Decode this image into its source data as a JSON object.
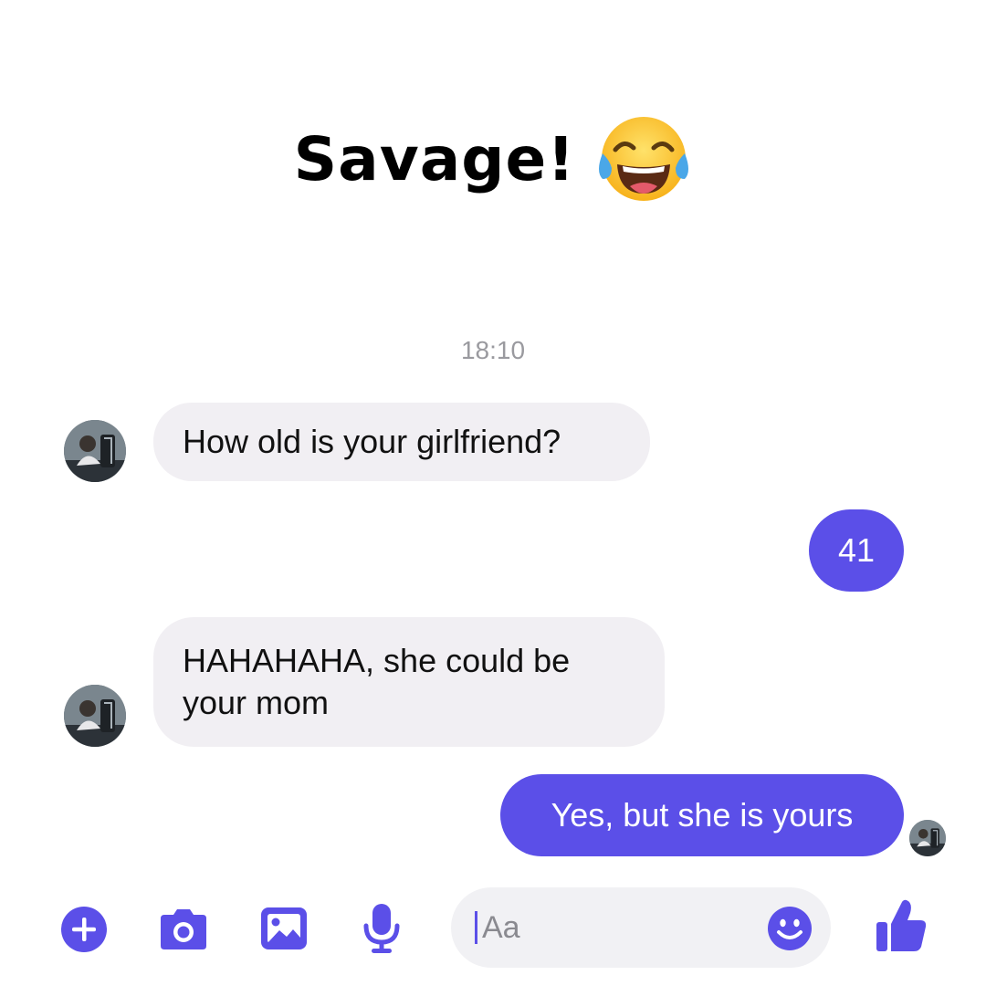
{
  "caption": {
    "text": "Savage!",
    "emoji_icon": "tears-of-joy-emoji"
  },
  "conversation": {
    "timestamp": "18:10",
    "messages": [
      {
        "direction": "incoming",
        "text": "How old is your girlfriend?"
      },
      {
        "direction": "outgoing",
        "text": "41"
      },
      {
        "direction": "incoming",
        "text": "HAHAHAHA, she could be your mom"
      },
      {
        "direction": "outgoing",
        "text": "Yes, but she is yours"
      }
    ]
  },
  "composer": {
    "placeholder": "Aa",
    "icons": [
      "plus-circle-icon",
      "camera-icon",
      "gallery-icon",
      "microphone-icon",
      "smiley-icon",
      "thumbs-up-icon"
    ]
  },
  "colors": {
    "accent": "#5b4fe8",
    "incoming_bubble": "#f1eff3",
    "outgoing_text": "#ffffff",
    "timestamp": "#9a9a9f"
  }
}
